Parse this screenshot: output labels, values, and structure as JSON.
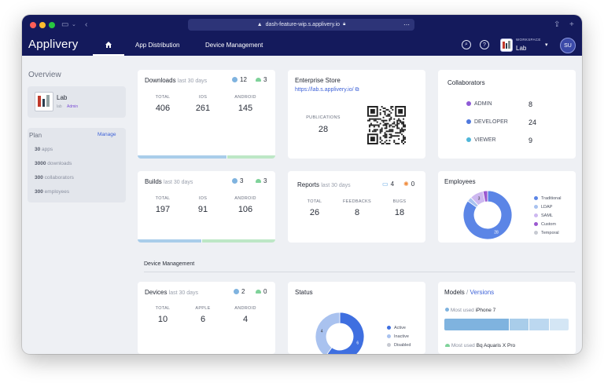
{
  "browser": {
    "url": "dash-feature-wip.s.applivery.io",
    "colors": {
      "close": "#ff5f57",
      "minimize": "#febc2e",
      "maximize": "#28c840"
    }
  },
  "nav": {
    "logo": "Applivery",
    "app_distribution": "App Distribution",
    "device_management": "Device Management",
    "workspace_label": "WORKSPACE",
    "workspace_name": "Lab",
    "avatar": "SU"
  },
  "sidebar": {
    "title": "Overview",
    "workspace": {
      "name": "Lab",
      "sub": "lab",
      "role": "Admin"
    },
    "plan": {
      "label": "Plan",
      "manage": "Manage",
      "items": [
        {
          "count": "30",
          "text": "apps"
        },
        {
          "count": "3000",
          "text": "downloads"
        },
        {
          "count": "300",
          "text": "collaborators"
        },
        {
          "count": "300",
          "text": "employees"
        }
      ]
    }
  },
  "downloads": {
    "title": "Downloads",
    "period": "last 30 days",
    "ios_count": "12",
    "android_count": "3",
    "stats": [
      {
        "label": "TOTAL",
        "value": "406"
      },
      {
        "label": "IOS",
        "value": "261"
      },
      {
        "label": "ANDROID",
        "value": "145"
      }
    ]
  },
  "enterprise": {
    "title": "Enterprise Store",
    "link": "https://lab.s.applivery.io/",
    "publications_label": "PUBLICATIONS",
    "publications_value": "28"
  },
  "collaborators": {
    "title": "Collaborators",
    "rows": [
      {
        "label": "ADMIN",
        "value": "8",
        "color": "#8e5ad6"
      },
      {
        "label": "DEVELOPER",
        "value": "24",
        "color": "#4f78dd"
      },
      {
        "label": "VIEWER",
        "value": "9",
        "color": "#4fb6d9"
      }
    ]
  },
  "builds": {
    "title": "Builds",
    "period": "last 30 days",
    "ios_count": "3",
    "android_count": "3",
    "stats": [
      {
        "label": "TOTAL",
        "value": "197"
      },
      {
        "label": "IOS",
        "value": "91"
      },
      {
        "label": "ANDROID",
        "value": "106"
      }
    ]
  },
  "reports": {
    "title": "Reports",
    "period": "last 30 days",
    "feedback_count": "4",
    "bug_count": "0",
    "stats": [
      {
        "label": "TOTAL",
        "value": "26"
      },
      {
        "label": "FEEDBACKS",
        "value": "8"
      },
      {
        "label": "BUGS",
        "value": "18"
      }
    ]
  },
  "employees": {
    "title": "Employees",
    "segments": [
      {
        "label": "Traditional",
        "value": 28,
        "color": "#5b85e6"
      },
      {
        "label": "LDAP",
        "value": 1,
        "color": "#a9c2ef"
      },
      {
        "label": "SAML",
        "value": 3,
        "color": "#cdb8f0"
      },
      {
        "label": "Custom",
        "value": 1,
        "color": "#9b59d0"
      },
      {
        "label": "Temporal",
        "value": 0,
        "color": "#c7cad2"
      }
    ],
    "labels_shown": [
      "3",
      "28"
    ]
  },
  "device_section": {
    "title": "Device Management"
  },
  "devices": {
    "title": "Devices",
    "period": "last 30 days",
    "ios_count": "2",
    "android_count": "0",
    "stats": [
      {
        "label": "TOTAL",
        "value": "10"
      },
      {
        "label": "APPLE",
        "value": "6"
      },
      {
        "label": "ANDROID",
        "value": "4"
      }
    ]
  },
  "status": {
    "title": "Status",
    "segments": [
      {
        "label": "Active",
        "value": 6,
        "color": "#3f6fe0"
      },
      {
        "label": "Inactive",
        "value": 4,
        "color": "#a9c2ef"
      },
      {
        "label": "Disabled",
        "value": 0,
        "color": "#c7cad2"
      }
    ],
    "labels_shown": [
      "4",
      "6"
    ]
  },
  "models": {
    "title": "Models",
    "separator": "/",
    "versions": "Versions",
    "most_used_label": "Most used",
    "ios_model": "iPhone 7",
    "android_model": "Bq Aquaris X Pro"
  }
}
